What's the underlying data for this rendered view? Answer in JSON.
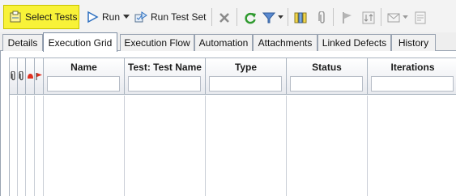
{
  "toolbar": {
    "select_tests_label": "Select Tests",
    "run_label": "Run",
    "run_test_set_label": "Run Test Set",
    "icons": [
      "select-tests-icon",
      "run-icon",
      "dropdown-arrow-icon",
      "run-test-set-icon",
      "delete-icon",
      "refresh-icon",
      "filter-icon",
      "filter-dropdown-icon",
      "columns-icon",
      "attachment-icon",
      "flag-icon",
      "sort-icon",
      "mail-icon",
      "mail-dropdown-icon",
      "notes-icon"
    ],
    "highlight_color": "#f8f238"
  },
  "tabs": [
    {
      "label": "Details",
      "active": false
    },
    {
      "label": "Execution Grid",
      "active": true
    },
    {
      "label": "Execution Flow",
      "active": false
    },
    {
      "label": "Automation",
      "active": false
    },
    {
      "label": "Attachments",
      "active": false
    },
    {
      "label": "Linked Defects",
      "active": false
    },
    {
      "label": "History",
      "active": false
    }
  ],
  "grid": {
    "indicator_icons": [
      "attachment-icon",
      "attachment-icon",
      "alert-icon",
      "flag-icon"
    ],
    "columns": [
      {
        "label": "Name",
        "filter_value": ""
      },
      {
        "label": "Test: Test Name",
        "filter_value": ""
      },
      {
        "label": "Type",
        "filter_value": ""
      },
      {
        "label": "Status",
        "filter_value": ""
      },
      {
        "label": "Iterations",
        "filter_value": ""
      }
    ]
  }
}
